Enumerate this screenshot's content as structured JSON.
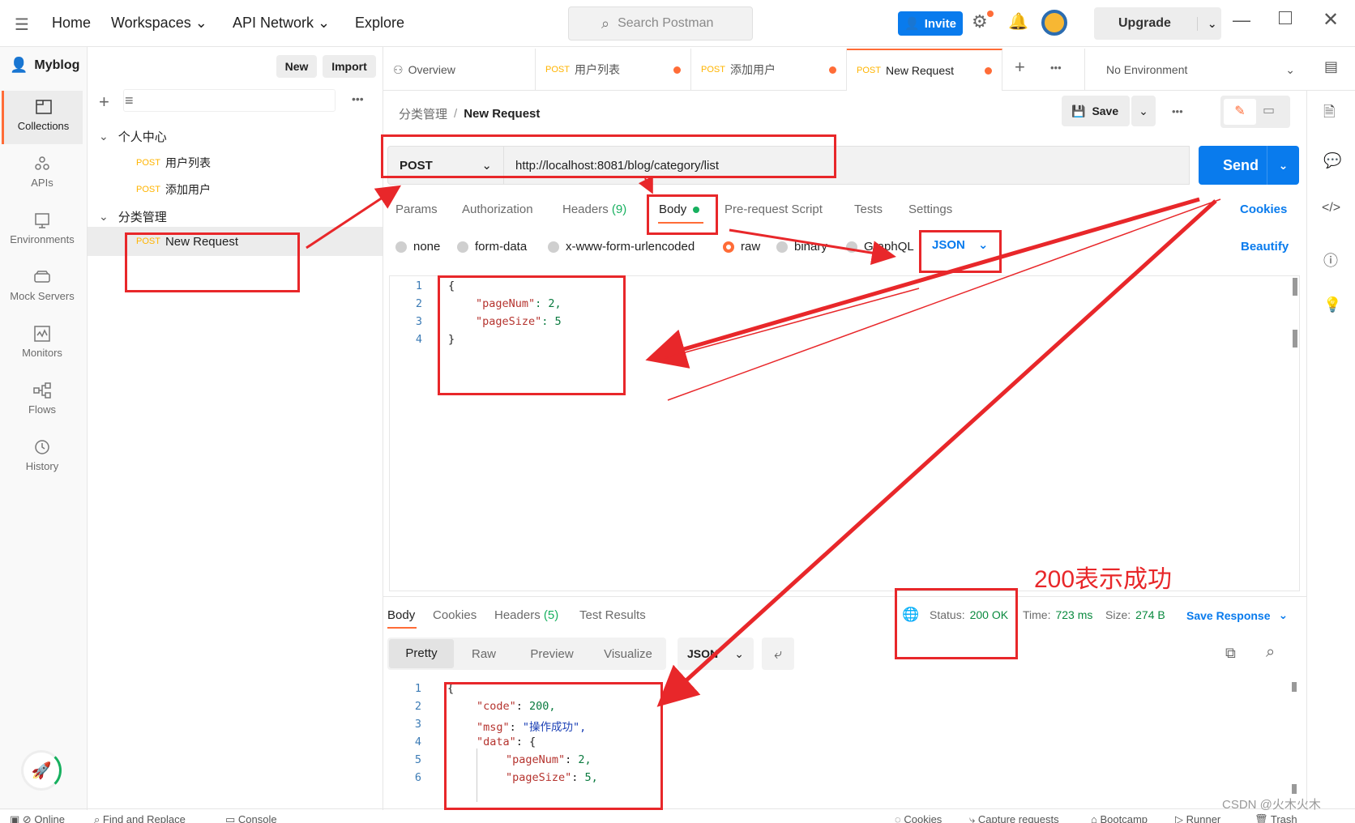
{
  "topbar": {
    "nav": [
      "Home",
      "Workspaces",
      "API Network",
      "Explore"
    ],
    "search_placeholder": "Search Postman",
    "invite": "Invite",
    "upgrade": "Upgrade"
  },
  "workspace": {
    "name": "Myblog",
    "new": "New",
    "import": "Import"
  },
  "rail": [
    {
      "label": "Collections",
      "icon": "collections-icon"
    },
    {
      "label": "APIs",
      "icon": "apis-icon"
    },
    {
      "label": "Environments",
      "icon": "environments-icon"
    },
    {
      "label": "Mock Servers",
      "icon": "mock-servers-icon"
    },
    {
      "label": "Monitors",
      "icon": "monitors-icon"
    },
    {
      "label": "Flows",
      "icon": "flows-icon"
    },
    {
      "label": "History",
      "icon": "history-icon"
    }
  ],
  "tree": {
    "folder1": "个人中心",
    "folder1_items": [
      {
        "method": "POST",
        "name": "用户列表"
      },
      {
        "method": "POST",
        "name": "添加用户"
      }
    ],
    "folder2": "分类管理",
    "folder2_items": [
      {
        "method": "POST",
        "name": "New Request"
      }
    ]
  },
  "tabs": [
    {
      "label": "Overview"
    },
    {
      "method": "POST",
      "label": "用户列表"
    },
    {
      "method": "POST",
      "label": "添加用户"
    },
    {
      "method": "POST",
      "label": "New Request"
    }
  ],
  "environment": "No Environment",
  "breadcrumb": {
    "parent": "分类管理",
    "sep": "/",
    "current": "New Request"
  },
  "save": "Save",
  "request": {
    "method": "POST",
    "url": "http://localhost:8081/blog/category/list",
    "send": "Send",
    "subtabs": [
      "Params",
      "Authorization",
      "Headers",
      "Body",
      "Pre-request Script",
      "Tests",
      "Settings"
    ],
    "headers_count": "(9)",
    "cookies": "Cookies",
    "body_modes": [
      "none",
      "form-data",
      "x-www-form-urlencoded",
      "raw",
      "binary",
      "GraphQL"
    ],
    "body_lang": "JSON",
    "beautify": "Beautify",
    "body_lines": [
      "1",
      "2",
      "3",
      "4"
    ],
    "body_code": [
      "{",
      "\"pageNum\"",
      ": 2,",
      "\"pageSize\"",
      ": 5",
      "}"
    ]
  },
  "annotation": "200表示成功",
  "response": {
    "tabs": [
      "Body",
      "Cookies",
      "Headers",
      "Test Results"
    ],
    "headers_count": "(5)",
    "status_label": "Status:",
    "status_value": "200 OK",
    "time_label": "Time:",
    "time_value": "723 ms",
    "size_label": "Size:",
    "size_value": "274 B",
    "save_response": "Save Response",
    "views": [
      "Pretty",
      "Raw",
      "Preview",
      "Visualize"
    ],
    "lang": "JSON",
    "lines": [
      "1",
      "2",
      "3",
      "4",
      "5",
      "6"
    ],
    "code": {
      "l1": "{",
      "l2k": "\"code\"",
      "l2v": "200,",
      "l3k": "\"msg\"",
      "l3v": "\"操作成功\",",
      "l4k": "\"data\"",
      "l4v": "{",
      "l5k": "\"pageNum\"",
      "l5v": "2,",
      "l6k": "\"pageSize\"",
      "l6v": "5,"
    }
  },
  "footer": [
    "Online",
    "Find and Replace",
    "Console",
    "Cookies",
    "Capture requests",
    "Bootcamp",
    "Runner",
    "Trash"
  ],
  "watermark": "CSDN @火木火木"
}
